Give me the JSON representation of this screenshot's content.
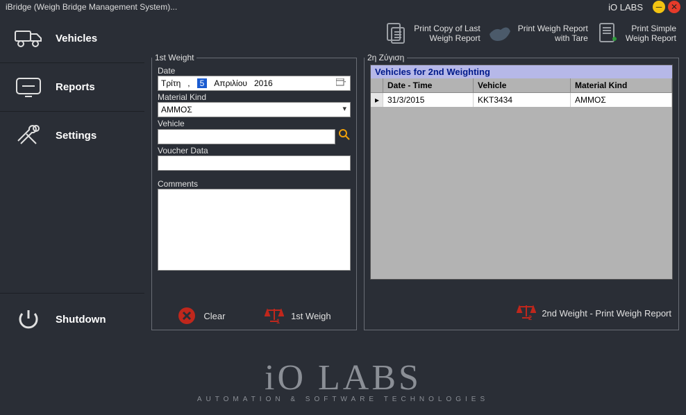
{
  "window": {
    "title": "iBridge (Weigh Bridge Management System)...",
    "brand": "iO LABS"
  },
  "sidebar": {
    "vehicles": "Vehicles",
    "reports": "Reports",
    "settings": "Settings",
    "shutdown": "Shutdown"
  },
  "toolbar": {
    "printCopyLast1": "Print Copy of Last",
    "printCopyLast2": "Weigh Report",
    "printTare1": "Print Weigh Report",
    "printTare2": "with Tare",
    "printSimple1": "Print Simple",
    "printSimple2": "Weigh Report"
  },
  "panel1": {
    "legend": "1st Weight",
    "dateLabel": "Date",
    "date": {
      "dayname": "Τρίτη",
      "comma": ",",
      "daynum": "5",
      "month": "Απριλίου",
      "year": "2016"
    },
    "materialLabel": "Material Kind",
    "materialValue": "ΑΜΜΟΣ",
    "vehicleLabel": "Vehicle",
    "vehicleValue": "",
    "voucherLabel": "Voucher Data",
    "voucherValue": "",
    "commentsLabel": "Comments",
    "commentsValue": "",
    "clear": "Clear",
    "firstWeigh": "1st Weigh"
  },
  "panel2": {
    "legend": "2η Ζύγιση",
    "gridTitle": "Vehicles for 2nd Weighting",
    "cols": {
      "dt": "Date - Time",
      "veh": "Vehicle",
      "mat": "Material Kind"
    },
    "rows": [
      {
        "dt": "31/3/2015",
        "veh": "KKT3434",
        "mat": "ΑΜΜΟΣ"
      }
    ],
    "action": "2nd Weight - Print Weigh Report"
  },
  "footer": {
    "logo": "iO LABS",
    "tag": "AUTOMATION & SOFTWARE TECHNOLOGIES"
  }
}
